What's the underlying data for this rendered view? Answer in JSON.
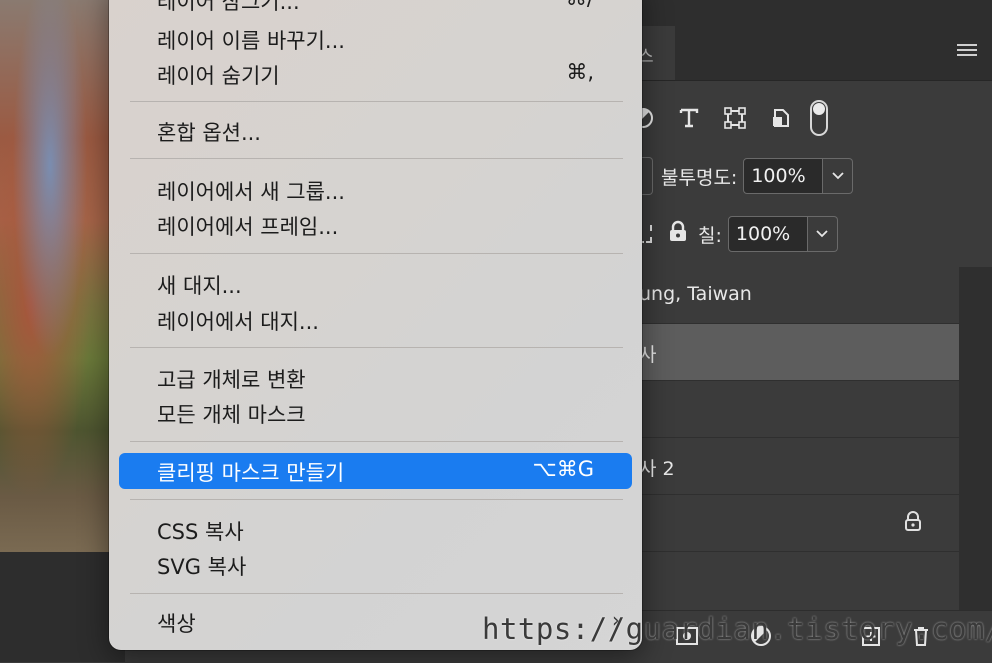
{
  "menu": {
    "items": [
      {
        "label": "레이어 잠그기...",
        "shortcut": "⌘/"
      },
      {
        "label": "레이어 이름 바꾸기...",
        "shortcut": ""
      },
      {
        "label": "레이어 숨기기",
        "shortcut": "⌘,"
      },
      {
        "label": "혼합 옵션...",
        "shortcut": ""
      },
      {
        "label": "레이어에서 새 그룹...",
        "shortcut": ""
      },
      {
        "label": "레이어에서 프레임...",
        "shortcut": ""
      },
      {
        "label": "새 대지...",
        "shortcut": ""
      },
      {
        "label": "레이어에서 대지...",
        "shortcut": ""
      },
      {
        "label": "고급 개체로 변환",
        "shortcut": ""
      },
      {
        "label": "모든 개체 마스크",
        "shortcut": ""
      },
      {
        "label": "클리핑 마스크 만들기",
        "shortcut": "⌥⌘G"
      },
      {
        "label": "CSS 복사",
        "shortcut": ""
      },
      {
        "label": "SVG 복사",
        "shortcut": ""
      },
      {
        "label": "색상",
        "shortcut": ""
      }
    ],
    "submenu_arrow": "›"
  },
  "layers_panel": {
    "tab_fragment": "스",
    "opacity": {
      "label": "불투명도:",
      "value": "100%"
    },
    "fill": {
      "label": "칠:",
      "value": "100%"
    },
    "filter_icons": [
      "adjustment-icon",
      "type-icon",
      "shape-icon",
      "smart-object-icon",
      "filter-toggle-icon"
    ],
    "layers": [
      {
        "name": "ung, Taiwan",
        "selected": false,
        "locked": false
      },
      {
        "name": "사",
        "selected": true,
        "locked": false
      },
      {
        "name": "",
        "selected": false,
        "locked": false
      },
      {
        "name": "사 2",
        "selected": false,
        "locked": false
      },
      {
        "name": "",
        "selected": false,
        "locked": true
      }
    ]
  },
  "watermark": "https://guardian.tistory.com/",
  "colors": {
    "highlight": "#1a7cf0",
    "panel_bg": "#3b3b3b",
    "menu_bg": "#d6d3d0"
  }
}
